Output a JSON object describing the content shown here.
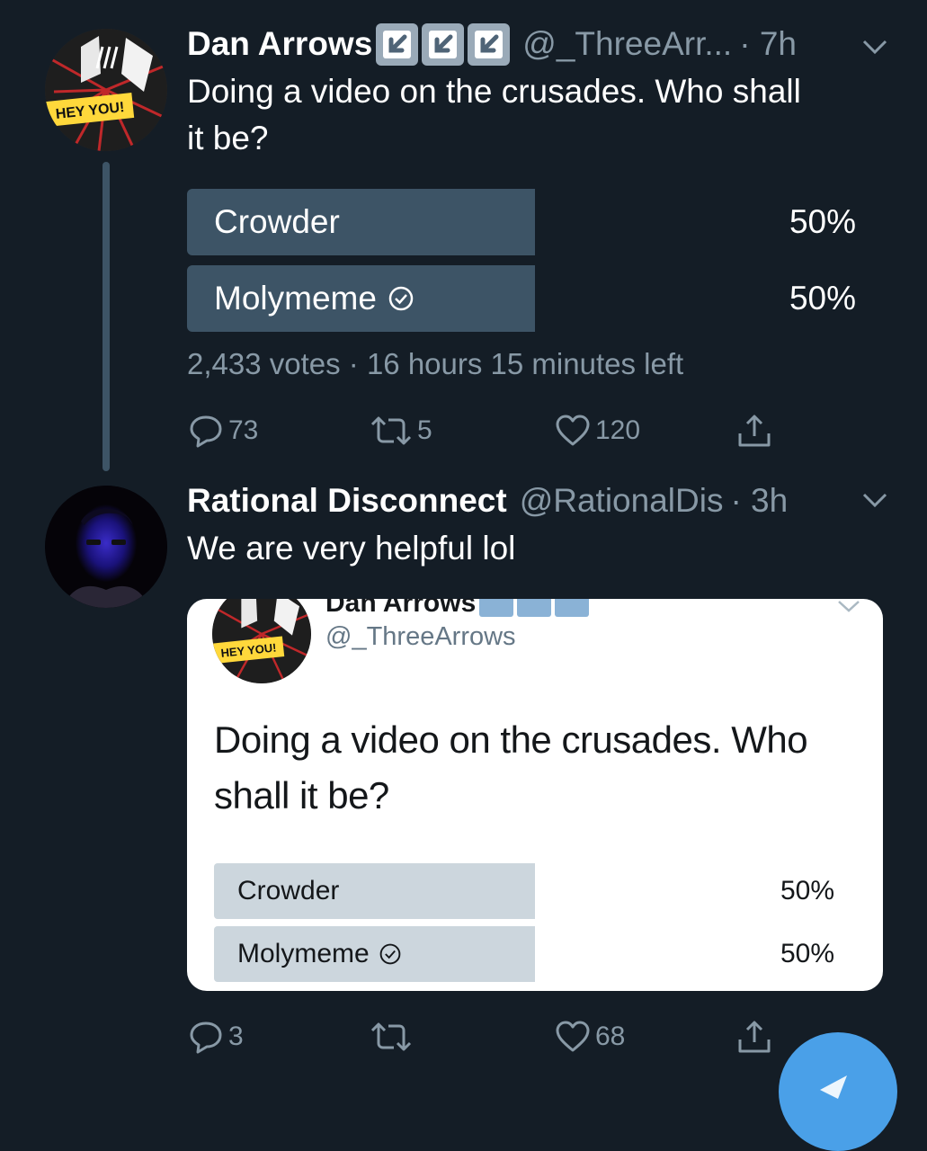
{
  "tweet1": {
    "display_name": "Dan Arrows",
    "handle": "@_ThreeArr...",
    "time": "· 7h",
    "text_line1": "Doing a video on the crusades. Who shall",
    "text_line2": "it be?",
    "avatar_label": "HEY YOU!",
    "poll": {
      "options": [
        {
          "label": "Crowder",
          "percent": "50%",
          "share": 0.5
        },
        {
          "label": "Molymeme",
          "percent": "50%",
          "share": 0.5
        }
      ],
      "meta": "2,433 votes · 16 hours 15 minutes left"
    },
    "actions": {
      "replies": "73",
      "retweets": "5",
      "likes": "120"
    }
  },
  "tweet2": {
    "display_name": "Rational Disconnect",
    "handle": "@RationalDis",
    "time": "· 3h",
    "text": "We are very helpful lol",
    "embed": {
      "display_name": "Dan Arrows",
      "handle": "@_ThreeArrows",
      "avatar_label": "HEY YOU!",
      "text_line1": "Doing a video on the crusades. Who",
      "text_line2": "shall it be?",
      "poll": {
        "options": [
          {
            "label": "Crowder",
            "percent": "50%",
            "share": 0.5
          },
          {
            "label": "Molymeme",
            "percent": "50%",
            "share": 0.5
          }
        ]
      }
    },
    "actions": {
      "replies": "3",
      "retweets": "",
      "likes": "68"
    }
  },
  "colors": {
    "background": "#141d26",
    "secondary_text": "#8899a6",
    "poll_bar_dark": "#3d5466",
    "poll_bar_light": "#ccd6dd",
    "accent": "#4aa0e8"
  }
}
